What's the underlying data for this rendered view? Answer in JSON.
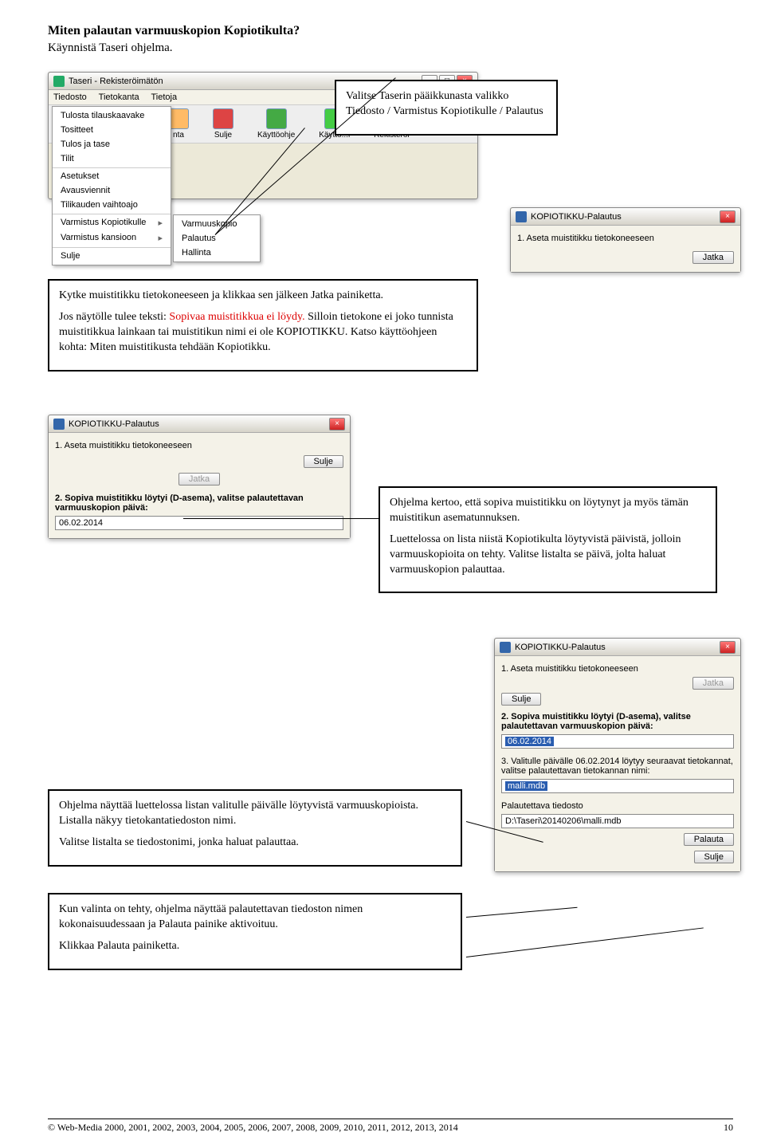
{
  "doc": {
    "title": "Miten palautan varmuuskopion Kopiotikulta?",
    "subtitle": "Käynnistä Taseri ohjelma."
  },
  "taseri_win": {
    "title": "Taseri - Rekisteröimätön",
    "menus": [
      "Tiedosto",
      "Tietokanta",
      "Tietoja"
    ],
    "dropdown1": [
      "Tulosta tilauskaavake",
      "Tositteet",
      "Tulos ja tase",
      "Tilit",
      "Asetukset",
      "Avausviennit",
      "Tilikauden vaihtoajo",
      "Varmistus Kopiotikulle",
      "Varmistus kansioon",
      "Sulje"
    ],
    "dropdown2": [
      "Varmuuskopio",
      "Palautus",
      "Hallinta"
    ],
    "toolbar": [
      {
        "label": "nta",
        "name": "toolbar-icon-1"
      },
      {
        "label": "Sulje",
        "name": "toolbar-close"
      },
      {
        "label": "Käyttöohje",
        "name": "toolbar-help-book"
      },
      {
        "label": "Käyttö...i",
        "name": "toolbar-help-question"
      },
      {
        "label": "Rekisteröi",
        "name": "toolbar-register"
      }
    ]
  },
  "box1": {
    "p1": "Valitse Taserin pääikkunasta valikko Tiedosto / Varmistus Kopiotikulle / Palautus"
  },
  "box2": {
    "p1": "Kytke muistitikku tietokoneeseen ja klikkaa sen jälkeen Jatka painiketta.",
    "p2a": "Jos näytölle tulee teksti: ",
    "p2red": "Sopivaa muistitikkua ei löydy.",
    "p2b": " Silloin tietokone ei joko tunnista muistitikkua lainkaan tai muistitikun nimi ei ole KOPIOTIKKU. Katso käyttöohjeen kohta: Miten muistitikusta tehdään Kopiotikku."
  },
  "box3": {
    "p1": "Ohjelma kertoo, että sopiva muistitikku on löytynyt ja myös tämän muistitikun asematunnuksen.",
    "p2": "Luettelossa on lista niistä Kopiotikulta löytyvistä päivistä, jolloin varmuuskopioita on tehty. Valitse listalta se päivä, jolta haluat varmuuskopion palauttaa."
  },
  "box4": {
    "p1": "Ohjelma näyttää luettelossa listan valitulle päivälle löytyvistä varmuuskopioista. Listalla näkyy tietokantatiedoston nimi.",
    "p2": "Valitse listalta se tiedostonimi, jonka haluat palauttaa."
  },
  "box5": {
    "p1": "Kun valinta on tehty, ohjelma näyttää palautettavan tiedoston nimen kokonaisuudessaan ja Palauta painike aktivoituu.",
    "p2": "Klikkaa Palauta painiketta."
  },
  "dlg": {
    "title": "KOPIOTIKKU-Palautus",
    "step1": "1. Aseta muistitikku tietokoneeseen",
    "step2": "2. Sopiva muistitikku löytyi (D-asema), valitse palautettavan varmuuskopion päivä:",
    "step3": "3. Valitulle päivälle 06.02.2014 löytyy seuraavat tietokannat, valitse palautettavan tietokannan nimi:",
    "restore_label": "Palautettava tiedosto",
    "restore_path": "D:\\Taseri\\20140206\\malli.mdb",
    "date": "06.02.2014",
    "db": "malli.mdb",
    "btn_jatka": "Jatka",
    "btn_sulje": "Sulje",
    "btn_palauta": "Palauta"
  },
  "footer": {
    "copyright": "© Web-Media 2000, 2001, 2002, 2003, 2004, 2005, 2006, 2007, 2008, 2009, 2010, 2011, 2012, 2013, 2014",
    "page": "10"
  }
}
